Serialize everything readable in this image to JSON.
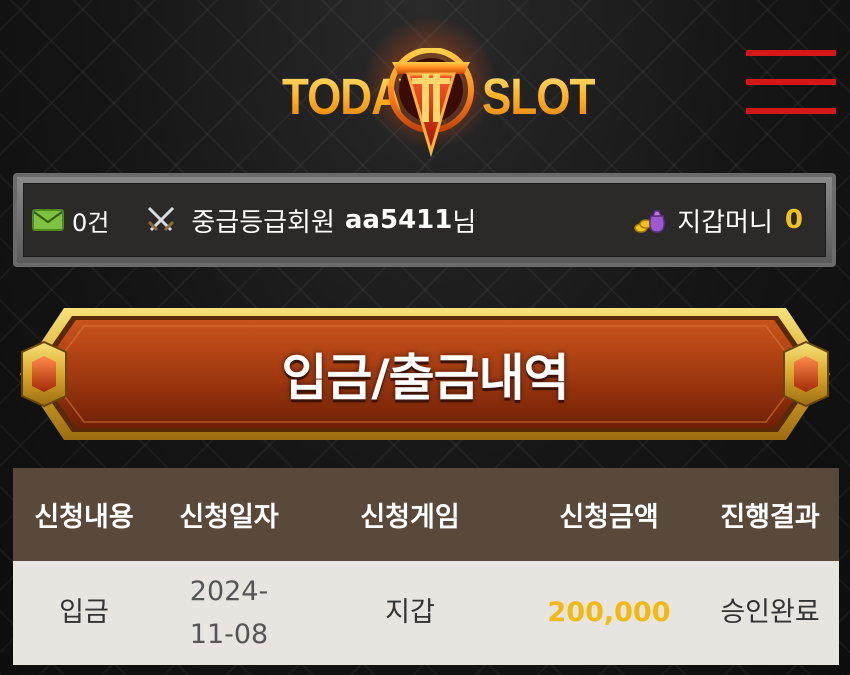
{
  "header": {
    "logo": {
      "word_left": "TODAY",
      "word_right": "SLOT"
    },
    "menu_icon": "hamburger-icon",
    "menu_color": "#d41818"
  },
  "info_bar": {
    "message_icon": "envelope-icon",
    "message_count": "0건",
    "member_icon": "crossed-swords-icon",
    "member_grade": "중급등급회원",
    "member_id": "aa5411",
    "member_suffix": "님",
    "wallet_icon": "money-bag-icon",
    "wallet_label": "지갑머니",
    "wallet_amount": "0",
    "wallet_amount_color": "#f3c21b"
  },
  "banner": {
    "title": "입금/출금내역"
  },
  "table": {
    "headers": [
      "신청내용",
      "신청일자",
      "신청게임",
      "신청금액",
      "진행결과"
    ],
    "rows": [
      {
        "type": "입금",
        "date": "2024-11-08",
        "game": "지갑",
        "amount": "200,000",
        "status": "승인완료"
      }
    ],
    "header_bg": "#59493a",
    "row_bg": "#e8e4df",
    "amount_color": "#f2b90f"
  }
}
